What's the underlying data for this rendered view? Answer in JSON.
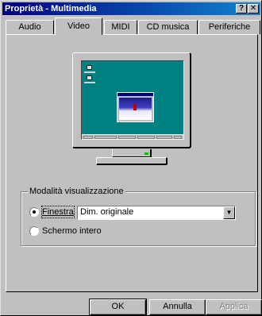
{
  "window": {
    "title": "Proprietà - Multimedia",
    "help_btn": "?",
    "close_btn": "✕"
  },
  "tabs": [
    {
      "label": "Audio"
    },
    {
      "label": "Video"
    },
    {
      "label": "MIDI"
    },
    {
      "label": "CD musica"
    },
    {
      "label": "Periferiche"
    }
  ],
  "active_tab": "Video",
  "display_group": {
    "legend": "Modalità visualizzazione",
    "window_option": "Finestra",
    "fullscreen_option": "Schermo intero",
    "selected": "Finestra",
    "size_select": {
      "value": "Dim. originale"
    }
  },
  "buttons": {
    "ok": "OK",
    "cancel": "Annulla",
    "apply": "Applica"
  },
  "colors": {
    "title_start": "#000080",
    "title_end": "#1084d0",
    "face": "#c0c0c0",
    "desktop": "#008080"
  },
  "icons": [
    "question-icon",
    "close-icon",
    "dropdown-arrow-icon",
    "monitor-preview-icon"
  ]
}
